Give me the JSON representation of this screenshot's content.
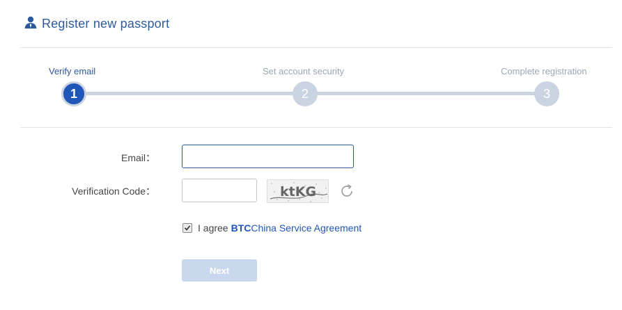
{
  "header": {
    "title": "Register new passport",
    "icon": "user-icon",
    "accent": "#2d5a9e"
  },
  "steps": [
    {
      "label": "Verify email",
      "number": "1",
      "active": true
    },
    {
      "label": "Set account security",
      "number": "2",
      "active": false
    },
    {
      "label": "Complete registration",
      "number": "3",
      "active": false
    }
  ],
  "form": {
    "email_label": "Email：",
    "email_value": "",
    "code_label": "Verification Code：",
    "code_value": "",
    "captcha_text": "ktKG",
    "refresh_icon": "refresh-icon"
  },
  "agreement": {
    "checked": true,
    "prefix": "I agree",
    "brand": "BTC",
    "link": "China Service Agreement"
  },
  "next_label": "Next"
}
